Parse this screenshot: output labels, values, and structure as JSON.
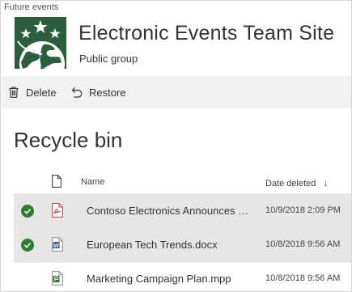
{
  "site": {
    "breadcrumb": "Future events",
    "title": "Electronic Events Team Site",
    "subtitle": "Public group",
    "logo_color": "#2b5e3b"
  },
  "commands": {
    "delete_label": "Delete",
    "delete_icon": "trash-icon",
    "restore_label": "Restore",
    "restore_icon": "restore-icon"
  },
  "page": {
    "title": "Recycle bin"
  },
  "table": {
    "columns": {
      "file_type_icon": "document-icon",
      "name": "Name",
      "date_deleted": "Date deleted",
      "sort_icon": "sort-down-icon"
    },
    "rows": [
      {
        "selected": true,
        "file_type": "pdf-icon",
        "name": "Contoso Electronics Announces Partnership.pdf",
        "date": "10/9/2018 2:09 PM"
      },
      {
        "selected": true,
        "file_type": "word-icon",
        "name": "European Tech Trends.docx",
        "date": "10/8/2018 9:56 AM"
      },
      {
        "selected": false,
        "file_type": "project-icon",
        "name": "Marketing Campaign Plan.mpp",
        "date": "10/8/2018 9:56 AM"
      }
    ]
  },
  "colors": {
    "check": "#2f7d32",
    "selected_row": "#e6e6e6",
    "command_bar": "#f1f1f1"
  }
}
